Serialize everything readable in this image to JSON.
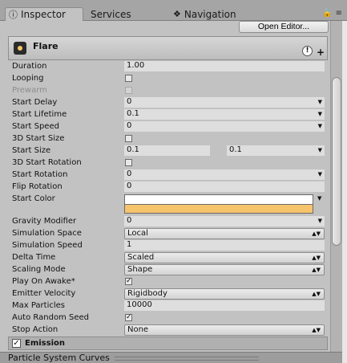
{
  "tabs": [
    {
      "label": "Inspector",
      "icon": "info-icon",
      "active": true
    },
    {
      "label": "Services",
      "active": false
    },
    {
      "label": "Navigation",
      "icon": "navigation-icon",
      "active": false
    }
  ],
  "toolbar": {
    "open_editor_label": "Open Editor..."
  },
  "module": {
    "title": "Flare",
    "icon": "particle-flare-icon"
  },
  "props": {
    "duration": {
      "label": "Duration",
      "value": "1.00"
    },
    "looping": {
      "label": "Looping",
      "checked": false
    },
    "prewarm": {
      "label": "Prewarm",
      "checked": false,
      "disabled": true
    },
    "start_delay": {
      "label": "Start Delay",
      "value": "0"
    },
    "start_lifetime": {
      "label": "Start Lifetime",
      "value": "0.1"
    },
    "start_speed": {
      "label": "Start Speed",
      "value": "0"
    },
    "start_size_3d": {
      "label": "3D Start Size",
      "checked": false
    },
    "start_size": {
      "label": "Start Size",
      "value_a": "0.1",
      "value_b": "0.1"
    },
    "start_rotation_3d": {
      "label": "3D Start Rotation",
      "checked": false
    },
    "start_rotation": {
      "label": "Start Rotation",
      "value": "0"
    },
    "flip_rotation": {
      "label": "Flip Rotation",
      "value": "0"
    },
    "start_color": {
      "label": "Start Color",
      "color_top": "#ffffff",
      "color_bottom": "#f6c46c"
    },
    "gravity_modifier": {
      "label": "Gravity Modifier",
      "value": "0"
    },
    "simulation_space": {
      "label": "Simulation Space",
      "value": "Local"
    },
    "simulation_speed": {
      "label": "Simulation Speed",
      "value": "1"
    },
    "delta_time": {
      "label": "Delta Time",
      "value": "Scaled"
    },
    "scaling_mode": {
      "label": "Scaling Mode",
      "value": "Shape"
    },
    "play_on_awake": {
      "label": "Play On Awake*",
      "checked": true
    },
    "emitter_velocity": {
      "label": "Emitter Velocity",
      "value": "Rigidbody"
    },
    "max_particles": {
      "label": "Max Particles",
      "value": "10000"
    },
    "auto_random_seed": {
      "label": "Auto Random Seed",
      "checked": true
    },
    "stop_action": {
      "label": "Stop Action",
      "value": "None"
    }
  },
  "emission": {
    "label": "Emission",
    "checked": true
  },
  "curves": {
    "label": "Particle System Curves"
  }
}
